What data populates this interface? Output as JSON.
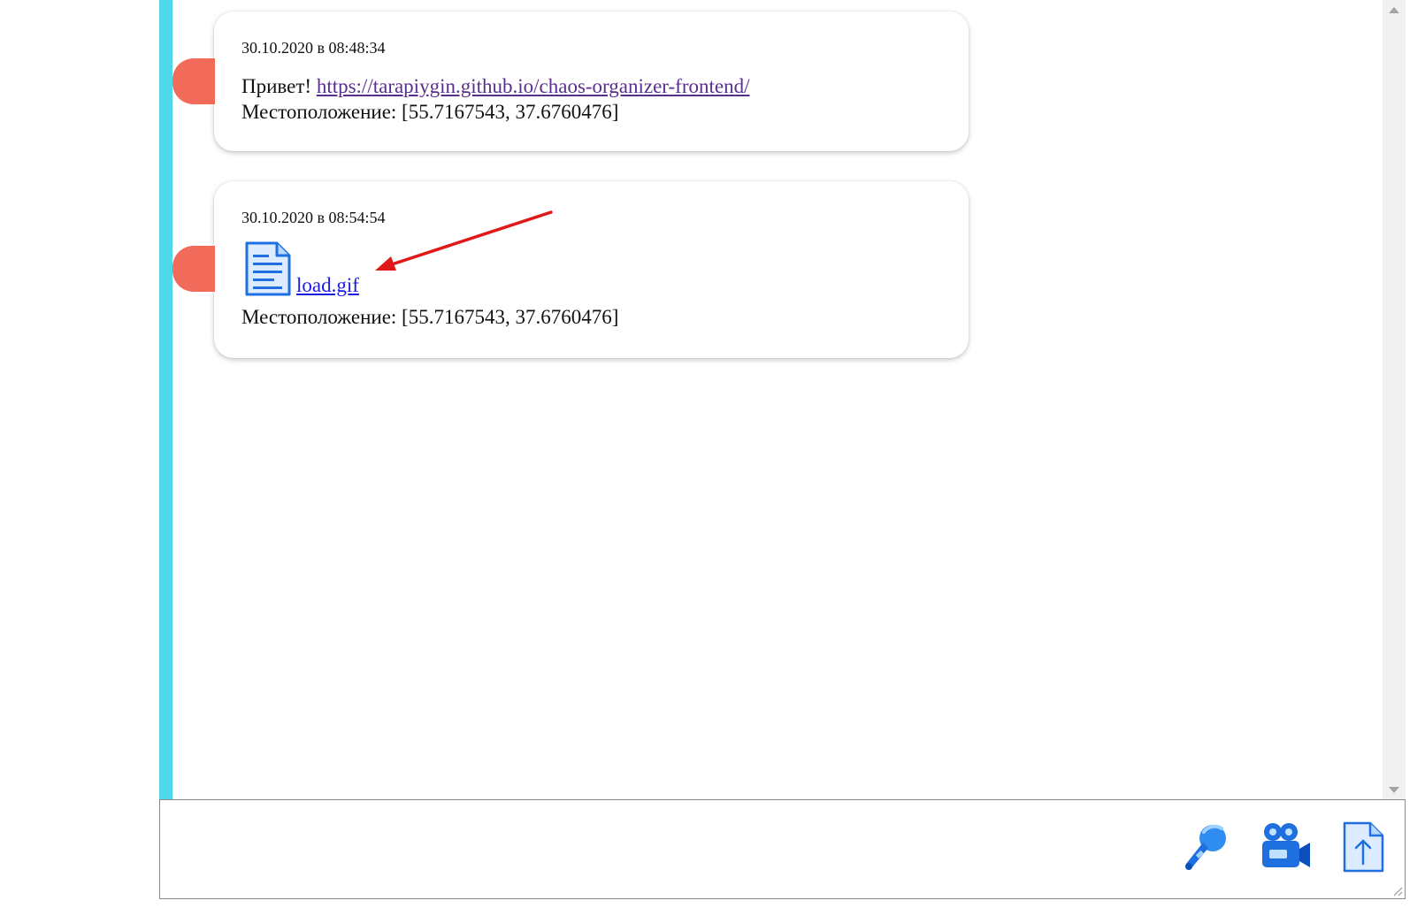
{
  "messages": [
    {
      "timestamp": "30.10.2020 в 08:48:34",
      "text_prefix": "Привет! ",
      "link": "https://tarapiygin.github.io/chaos-organizer-frontend/",
      "location_label": "Местоположение: [55.7167543, 37.6760476]"
    },
    {
      "timestamp": "30.10.2020 в 08:54:54",
      "file_icon": "document-icon",
      "file_name": " load.gif",
      "location_label": "Местоположение: [55.7167543, 37.6760476]"
    }
  ],
  "composer": {
    "value": "",
    "placeholder": "",
    "tools": [
      {
        "icon": "microphone-icon"
      },
      {
        "icon": "video-camera-icon"
      },
      {
        "icon": "file-upload-icon"
      }
    ]
  },
  "colors": {
    "timeline_bar": "#4fd8e8",
    "marker": "#f26a5a",
    "visited_link": "#5a2f8c",
    "file_link": "#1a1ae0",
    "icon_blue": "#1e6fe0",
    "annotation_arrow": "#e01818"
  }
}
